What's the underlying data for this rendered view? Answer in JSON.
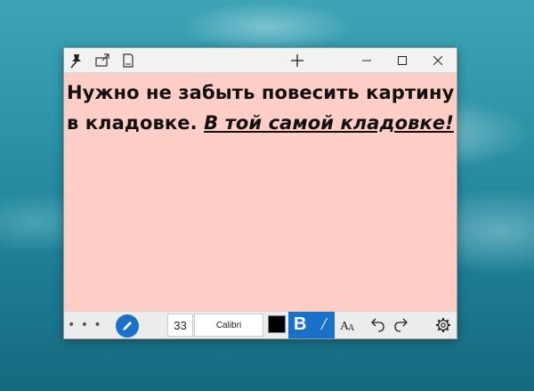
{
  "window": {
    "titlebar": {
      "icons": [
        "pin-icon",
        "share-icon",
        "note-icon"
      ],
      "new_note_icon": "plus-icon",
      "controls": [
        "minimize-icon",
        "maximize-icon",
        "close-icon"
      ]
    },
    "note": {
      "line1": "Нужно не забыть повесить картину",
      "line2_plain": "в кладовке. ",
      "line2_emphasis": "В той самой кладовке!",
      "background_color": "#ffcfc7"
    },
    "toolbar": {
      "more_icon": "more-dots-icon",
      "more_label": "• • •",
      "pen_icon": "pen-icon",
      "font_size": "33",
      "font_name": "Calibri",
      "text_color": "#000000",
      "bold_label": "B",
      "italic_label": "/",
      "accent_color": "#1a72c8",
      "tools": [
        "text-size-icon",
        "undo-icon",
        "redo-icon",
        "settings-icon"
      ]
    }
  }
}
